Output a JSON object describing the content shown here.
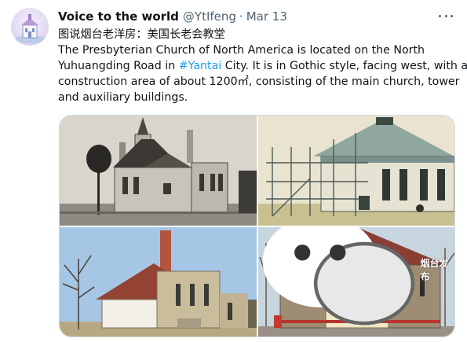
{
  "tweet": {
    "display_name": "Voice to the world",
    "handle": "@YtIfeng",
    "separator": "·",
    "time": "Mar 13",
    "lines": [
      "图说烟台老洋房：美国长老会教堂",
      "The Presbyterian Church of North America is located on the North",
      "Yuhuangding Road in ",
      "construction area of about 1200㎡, consisting of the main church, tower",
      "and auxiliary buildings."
    ],
    "hashtag": "#Yantai",
    "line3_tail": " City. It is in Gothic style, facing west, with a"
  },
  "media": {
    "watermark": "烟台发布"
  },
  "icons": {
    "more": "more-icon",
    "watermark_logo": "wechat-icon"
  },
  "colors": {
    "link": "#1d9bf0",
    "secondary_text": "#536471",
    "primary_text": "#0f1419"
  }
}
